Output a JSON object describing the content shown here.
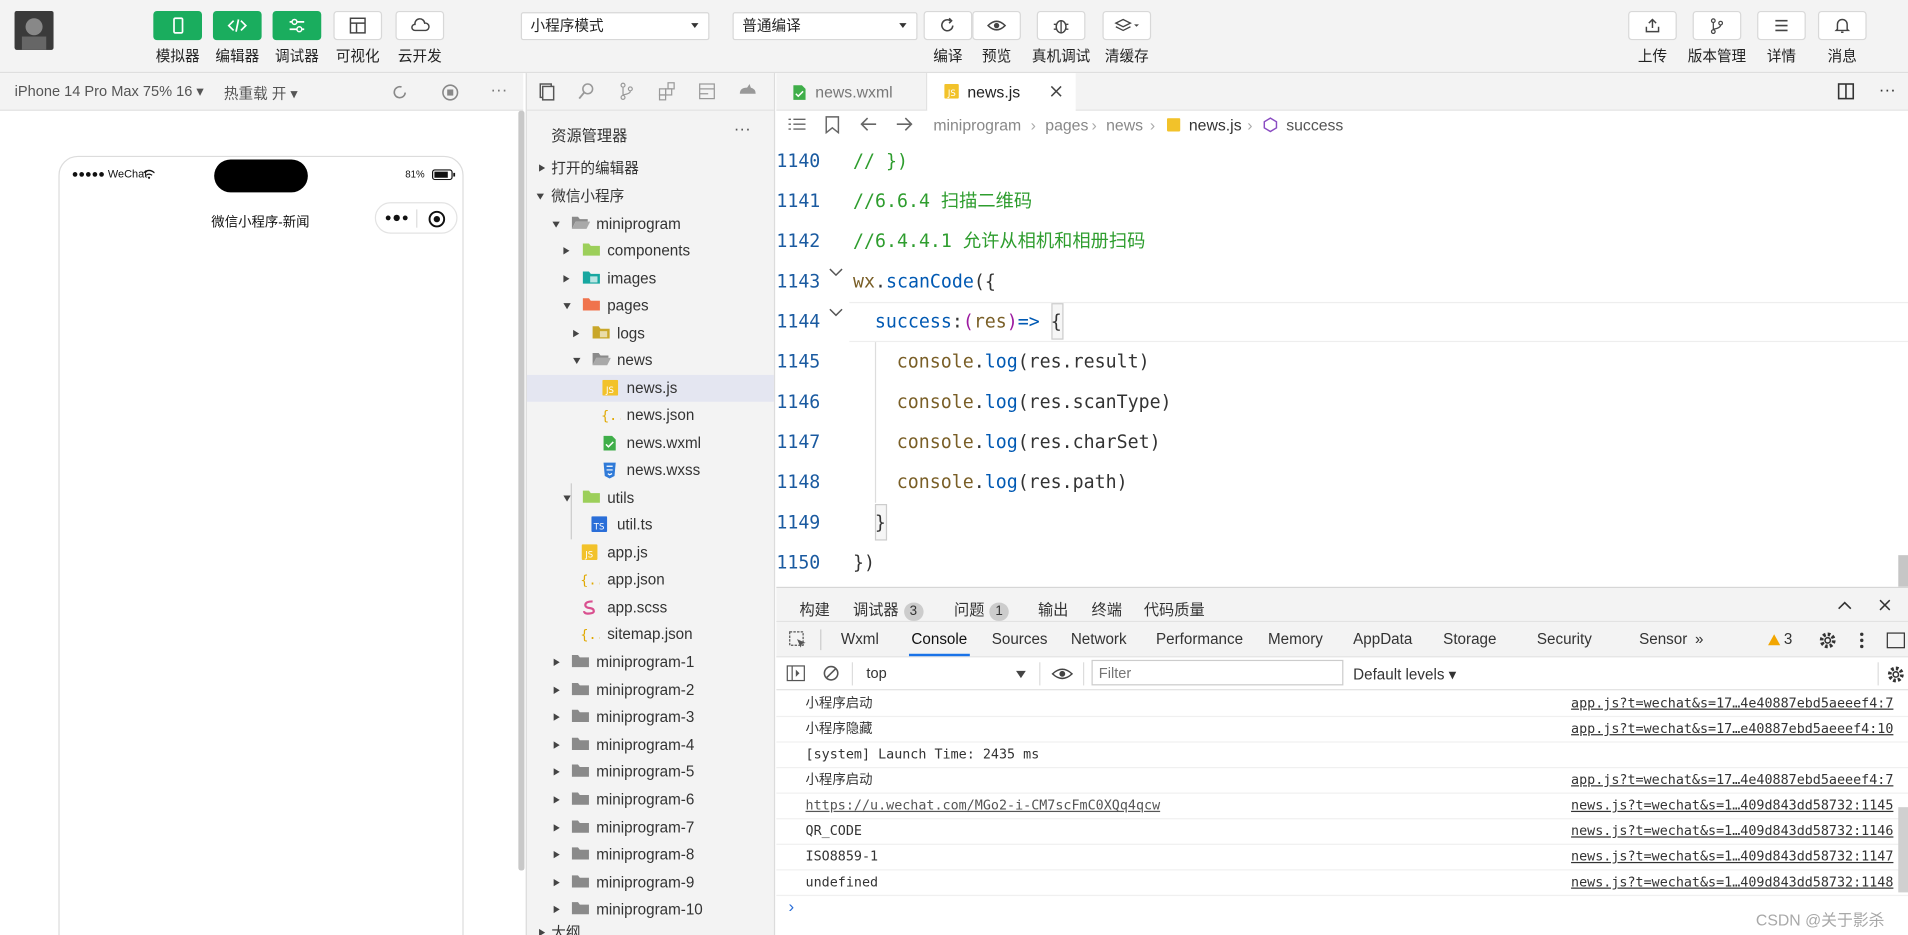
{
  "toolbar": {
    "simulator": "模拟器",
    "editor": "编辑器",
    "debugger": "调试器",
    "visual": "可视化",
    "cloud": "云开发",
    "mode": "小程序模式",
    "compile_mode": "普通编译",
    "compile": "编译",
    "preview": "预览",
    "device_debug": "真机调试",
    "clear_cache": "清缓存",
    "upload": "上传",
    "version": "版本管理",
    "details": "详情",
    "messages": "消息"
  },
  "simbar": {
    "device": "iPhone 14 Pro Max 75% 16 ▾",
    "hot_reload": "热重载 开 ▾"
  },
  "phone": {
    "carrier": "●●●●● WeChat",
    "battery": "81%",
    "title": "微信小程序-新闻"
  },
  "explorer": {
    "title": "资源管理器",
    "sections": {
      "open_editors": "打开的编辑器",
      "project": "微信小程序",
      "outline": "大纲"
    },
    "items": [
      "miniprogram",
      "components",
      "images",
      "pages",
      "logs",
      "news",
      "news.js",
      "news.json",
      "news.wxml",
      "news.wxss",
      "utils",
      "util.ts",
      "app.js",
      "app.json",
      "app.scss",
      "sitemap.json",
      "miniprogram-1",
      "miniprogram-2",
      "miniprogram-3",
      "miniprogram-4",
      "miniprogram-5",
      "miniprogram-6",
      "miniprogram-7",
      "miniprogram-8",
      "miniprogram-9",
      "miniprogram-10"
    ]
  },
  "editor": {
    "tabs": [
      "news.wxml",
      "news.js"
    ],
    "breadcrumb": [
      "miniprogram",
      "pages",
      "news",
      "news.js",
      "success"
    ],
    "lines": [
      {
        "n": "1140",
        "t": "// })"
      },
      {
        "n": "1141",
        "t": "//6.6.4 扫描二维码"
      },
      {
        "n": "1142",
        "t": "//6.4.4.1 允许从相机和相册扫码"
      },
      {
        "n": "1143",
        "t": "wx.scanCode({"
      },
      {
        "n": "1144",
        "t": "success:(res)=> {"
      },
      {
        "n": "1145",
        "t": "console.log(res.result)"
      },
      {
        "n": "1146",
        "t": "console.log(res.scanType)"
      },
      {
        "n": "1147",
        "t": "console.log(res.charSet)"
      },
      {
        "n": "1148",
        "t": "console.log(res.path)"
      },
      {
        "n": "1149",
        "t": "}"
      },
      {
        "n": "1150",
        "t": "})"
      }
    ]
  },
  "devtools": {
    "panels": {
      "build": "构建",
      "debugger": "调试器",
      "debugger_count": "3",
      "issues": "问题",
      "issues_count": "1",
      "output": "输出",
      "terminal": "终端",
      "quality": "代码质量"
    },
    "tabs": [
      "Wxml",
      "Console",
      "Sources",
      "Network",
      "Performance",
      "Memory",
      "AppData",
      "Storage",
      "Security",
      "Sensor",
      "»"
    ],
    "warnings": "3",
    "context": "top",
    "filter_placeholder": "Filter",
    "levels": "Default levels ▾",
    "logs": [
      {
        "msg": "小程序启动",
        "src": "app.js?t=wechat&s=17…4e40887ebd5aeeef4:7"
      },
      {
        "msg": "小程序隐藏",
        "src": "app.js?t=wechat&s=17…e40887ebd5aeeef4:10"
      },
      {
        "msg": "[system] Launch Time: 2435 ms",
        "src": ""
      },
      {
        "msg": "小程序启动",
        "src": "app.js?t=wechat&s=17…4e40887ebd5aeeef4:7"
      },
      {
        "msg": "https://u.wechat.com/MGo2-i-CM7scFmC0XQq4qcw",
        "src": "news.js?t=wechat&s=1…409d843dd58732:1145"
      },
      {
        "msg": "QR_CODE",
        "src": "news.js?t=wechat&s=1…409d843dd58732:1146"
      },
      {
        "msg": "ISO8859-1",
        "src": "news.js?t=wechat&s=1…409d843dd58732:1147"
      },
      {
        "msg": "undefined",
        "src": "news.js?t=wechat&s=1…409d843dd58732:1148"
      }
    ],
    "prompt": "›"
  },
  "watermark": "CSDN @关于影杀"
}
